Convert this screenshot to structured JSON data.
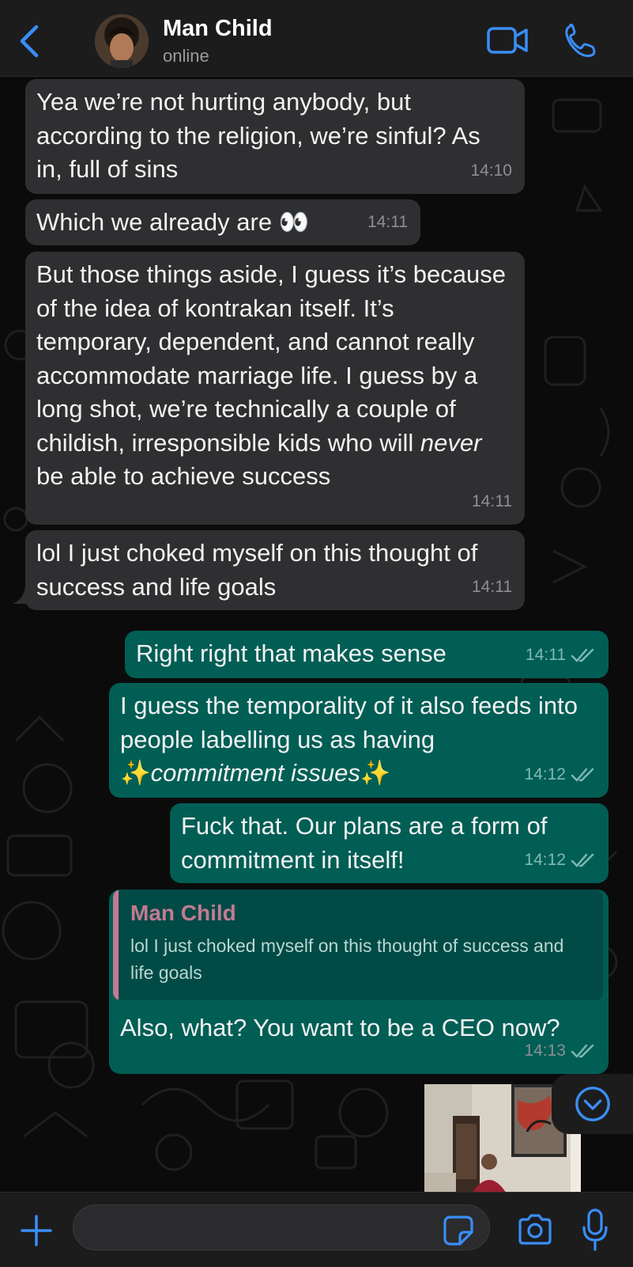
{
  "header": {
    "back_icon": "chevron-left-icon",
    "contact_name": "Man Child",
    "contact_status": "online",
    "video_icon": "video-camera-icon",
    "phone_icon": "phone-icon"
  },
  "colors": {
    "accent": "#3a8ef6",
    "incoming_bubble": "#2f2f31",
    "outgoing_bubble": "#005e55",
    "quote_name": "#c27a92"
  },
  "messages": [
    {
      "direction": "incoming",
      "text": "Yea we’re not hurting anybody, but according to the religion, we’re sinful? As in, full of sins",
      "time": "14:10"
    },
    {
      "direction": "incoming",
      "text": "Which we already are 👀",
      "time": "14:11"
    },
    {
      "direction": "incoming",
      "text_a": "But those things aside, I guess it’s because of the idea of kontrakan itself. It’s temporary, dependent, and cannot really accommodate marriage life. I guess by a long shot, we’re technically a couple of childish, irresponsible kids who will",
      "text_em": "never",
      "text_b": "be able to achieve success",
      "time": "14:11"
    },
    {
      "direction": "incoming",
      "text": "lol I just choked myself on this thought of success and life goals",
      "time": "14:11"
    },
    {
      "direction": "outgoing",
      "text": "Right right that makes sense",
      "time": "14:11",
      "status": "read"
    },
    {
      "direction": "outgoing",
      "text_a": "I guess the temporality of it also feeds into people labelling us as having",
      "text_b": "✨",
      "text_em": "commitment issues",
      "text_c": "✨",
      "time": "14:12",
      "status": "read"
    },
    {
      "direction": "outgoing",
      "text": "Fuck that. Our plans are a form of commitment in itself!",
      "time": "14:12",
      "status": "read"
    },
    {
      "direction": "outgoing",
      "quote": {
        "name": "Man Child",
        "text": "lol I just choked myself on this thought of success and life goals"
      },
      "text": "Also, what? You want to be a CEO now?",
      "time": "14:13",
      "status": "read"
    }
  ],
  "scroll_down_icon": "chevron-down-circle-icon",
  "input_bar": {
    "plus_icon": "plus-icon",
    "message_placeholder": "",
    "sticker_icon": "sticker-icon",
    "camera_icon": "camera-icon",
    "mic_icon": "microphone-icon"
  }
}
